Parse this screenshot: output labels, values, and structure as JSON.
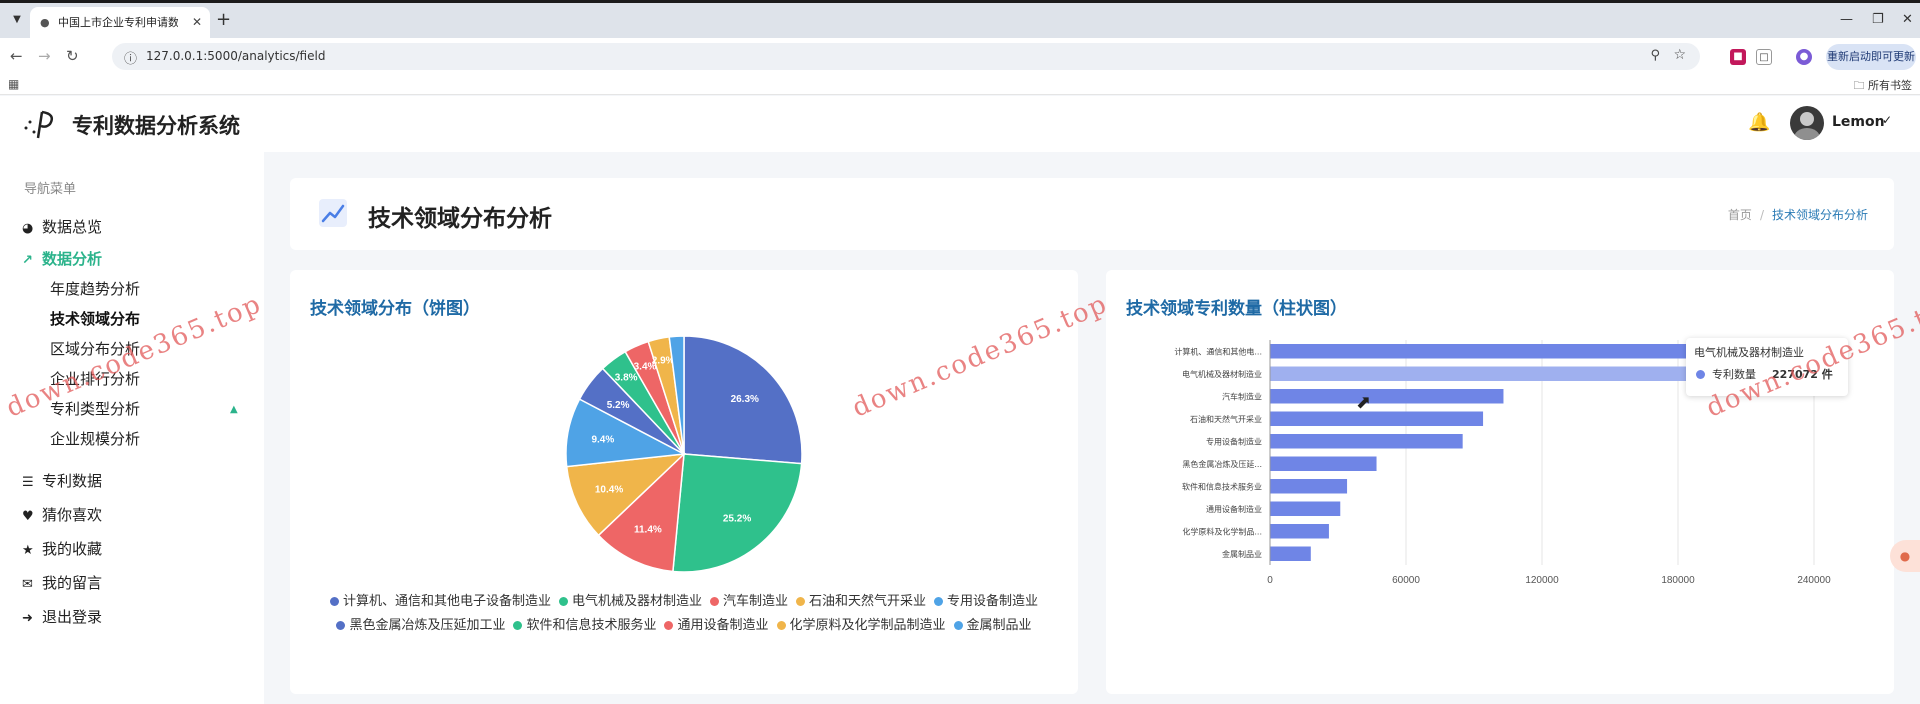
{
  "browser": {
    "tab_title": "中国上市企业专利申请数据分析",
    "url": "127.0.0.1:5000/analytics/field",
    "restart_label": "重新启动即可更新",
    "bookmarks_label": "所有书签"
  },
  "app": {
    "title": "专利数据分析系统",
    "user": "Lemon"
  },
  "sidebar": {
    "caption": "导航菜单",
    "items": [
      {
        "label": "数据总览"
      },
      {
        "label": "数据分析"
      },
      {
        "label": "专利数据"
      },
      {
        "label": "猜你喜欢"
      },
      {
        "label": "我的收藏"
      },
      {
        "label": "我的留言"
      },
      {
        "label": "退出登录"
      }
    ],
    "sub_items": [
      {
        "label": "年度趋势分析"
      },
      {
        "label": "技术领域分布"
      },
      {
        "label": "区域分布分析"
      },
      {
        "label": "企业排行分析"
      },
      {
        "label": "专利类型分析"
      },
      {
        "label": "企业规模分析"
      }
    ]
  },
  "page": {
    "title": "技术领域分布分析",
    "breadcrumb_home": "首页",
    "breadcrumb_current": "技术领域分布分析"
  },
  "colors": {
    "accent": "#2bb38b",
    "title_blue": "#1f6aa5",
    "bar": "#6f85e6",
    "bar_highlight": "#9fb0ef"
  },
  "tooltip": {
    "title": "电气机械及器材制造业",
    "label": "专利数量",
    "value": "227072 件"
  },
  "watermark": "down.code365.top",
  "chart_data": [
    {
      "type": "pie",
      "title": "技术领域分布（饼图）",
      "categories": [
        "计算机、通信和其他电子设备制造业",
        "电气机械及器材制造业",
        "汽车制造业",
        "石油和天然气开采业",
        "专用设备制造业",
        "黑色金属冶炼及压延加工业",
        "软件和信息技术服务业",
        "通用设备制造业",
        "化学原料及化学制品制造业",
        "金属制品业"
      ],
      "values": [
        26.3,
        25.2,
        11.4,
        10.4,
        9.4,
        5.2,
        3.8,
        3.4,
        2.9,
        2.0
      ],
      "labels": [
        "26.3%",
        "25.2%",
        "11.4%",
        "10.4%",
        "9.4%",
        "5.2%",
        "3.8%",
        "3.4%",
        "2.9%",
        ""
      ],
      "colors": [
        "#5470c6",
        "#2fc18c",
        "#ee6666",
        "#f0b54a",
        "#4fa3e6",
        "#5470c6",
        "#2fc18c",
        "#ee6666",
        "#f0b54a",
        "#4fa3e6"
      ],
      "legend_position": "bottom"
    },
    {
      "type": "bar",
      "orientation": "horizontal",
      "title": "技术领域专利数量（柱状图）",
      "categories": [
        "计算机、通信和其他电...",
        "电气机械及器材制造业",
        "汽车制造业",
        "石油和天然气开采业",
        "专用设备制造业",
        "黑色金属冶炼及压延...",
        "软件和信息技术服务业",
        "通用设备制造业",
        "化学原料及化学制品...",
        "金属制品业"
      ],
      "values": [
        237000,
        227072,
        103000,
        94000,
        85000,
        47000,
        34000,
        31000,
        26000,
        18000
      ],
      "xlim": [
        0,
        240000
      ],
      "xticks": [
        0,
        60000,
        120000,
        180000,
        240000
      ],
      "grid": true,
      "highlight_index": 1
    }
  ]
}
